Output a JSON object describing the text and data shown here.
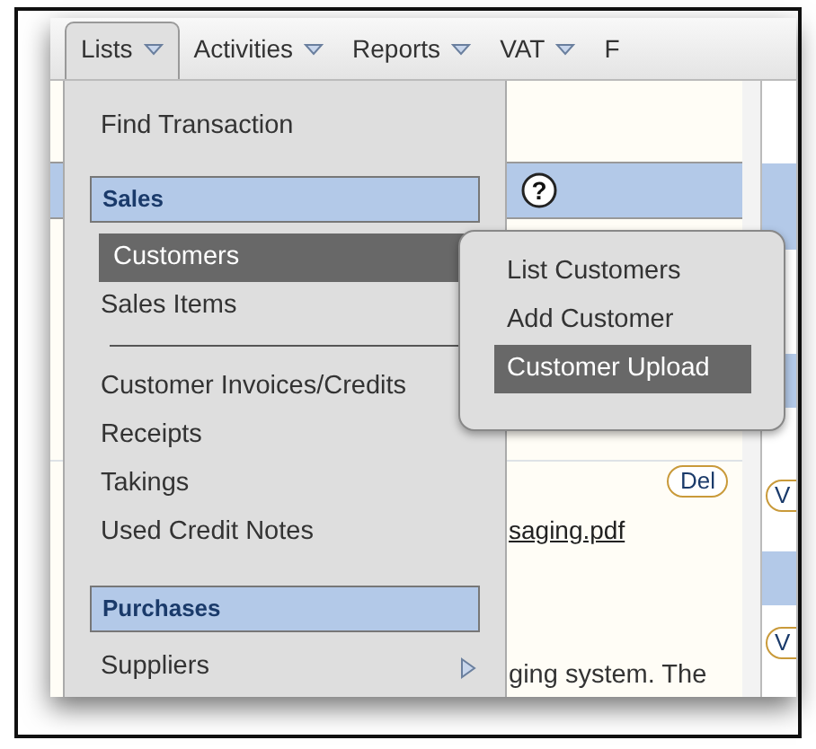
{
  "menubar": [
    {
      "label": "Lists",
      "kind": "dropdown",
      "selected": true
    },
    {
      "label": "Activities",
      "kind": "dropdown",
      "selected": false
    },
    {
      "label": "Reports",
      "kind": "dropdown",
      "selected": false
    },
    {
      "label": "VAT",
      "kind": "dropdown",
      "selected": false
    },
    {
      "label": "F",
      "kind": "partial",
      "selected": false
    }
  ],
  "menu": [
    {
      "kind": "item",
      "label": "Find Transaction",
      "selected": false
    },
    {
      "kind": "header",
      "label": "Sales"
    },
    {
      "kind": "item",
      "label": "Customers",
      "selected": true
    },
    {
      "kind": "item",
      "label": "Sales Items",
      "selected": false
    },
    {
      "kind": "separator"
    },
    {
      "kind": "item",
      "label": "Customer Invoices/Credits",
      "selected": false
    },
    {
      "kind": "item",
      "label": "Receipts",
      "selected": false
    },
    {
      "kind": "item",
      "label": "Takings",
      "selected": false
    },
    {
      "kind": "item",
      "label": "Used Credit Notes",
      "selected": false
    },
    {
      "kind": "header",
      "label": "Purchases"
    },
    {
      "kind": "submenu",
      "label": "Suppliers",
      "selected": false
    }
  ],
  "submenu": [
    {
      "label": "List Customers",
      "selected": false
    },
    {
      "label": "Add Customer",
      "selected": false
    },
    {
      "label": "Customer Upload",
      "selected": true
    }
  ],
  "background": {
    "help": "?",
    "delete_button": "Del",
    "link": "saging.pdf",
    "text": "ging system. The",
    "side_buttons": [
      "V",
      "V"
    ]
  }
}
